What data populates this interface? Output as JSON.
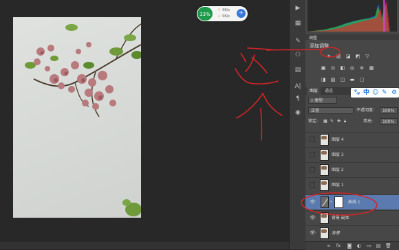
{
  "net_meter": {
    "percent": "33%",
    "upload": "0K/s",
    "download": "0K/s"
  },
  "adjustments": {
    "tab_label": "调整",
    "add_label": "添加调整"
  },
  "layers_panel": {
    "tabs": [
      "图层",
      "通道"
    ],
    "ime": {
      "zh": "中",
      "icons": [
        "paw-icon",
        "emoji-icon",
        "pen-icon",
        "settings-icon"
      ]
    },
    "filter_kind": "类型",
    "blend_mode": "正常",
    "opacity_label": "不透明度:",
    "opacity_value": "100%",
    "lock_label": "锁定:",
    "fill_label": "填充:",
    "fill_value": "100%",
    "layers": [
      {
        "name": "图层 4",
        "selected": false,
        "type": "pixel",
        "visible": false
      },
      {
        "name": "图层 3",
        "selected": false,
        "type": "pixel",
        "visible": false
      },
      {
        "name": "图层 2",
        "selected": false,
        "type": "pixel",
        "visible": false
      },
      {
        "name": "图层 1",
        "selected": false,
        "type": "pixel",
        "visible": false
      },
      {
        "name": "曲线 1",
        "selected": true,
        "type": "adjustment",
        "visible": true
      },
      {
        "name": "背景 副本",
        "selected": false,
        "type": "pixel",
        "visible": true
      },
      {
        "name": "背景",
        "selected": false,
        "type": "pixel",
        "visible": true
      }
    ]
  },
  "annotation": {
    "text": "这个",
    "color": "#d42525"
  },
  "colors": {
    "selection": "#5b7bb0",
    "annotation_red": "#d42525",
    "meter_green": "#1f9a4b"
  }
}
